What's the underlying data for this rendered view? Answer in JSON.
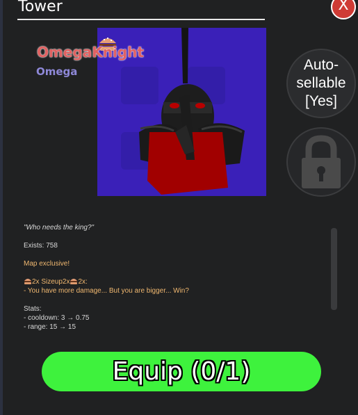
{
  "window": {
    "title": "Tower",
    "close_label": "X"
  },
  "tower": {
    "name": "OmegaKnight",
    "subtitle": "Omega",
    "icon": "burger-icon"
  },
  "autosell": {
    "line1": "Auto-",
    "line2": "sellable",
    "line3": "[Yes]"
  },
  "lock": {
    "icon": "padlock-icon",
    "locked": true
  },
  "description": {
    "quote": "\"Who needs the king?\"",
    "exists": "Exists: 758",
    "exclusive": "Map exclusive!",
    "ability_title": "2x Sizeup2x",
    "ability_suffix": "2x:",
    "ability_desc": "- You have more damage... But you are bigger... Win?",
    "stats_title": "Stats:",
    "stats": [
      "- cooldown: 3 → 0.75",
      "- range: 15 → 15"
    ]
  },
  "equip": {
    "label": "Equip (0/1)"
  },
  "colors": {
    "accent_green": "#3ef23d",
    "close_red": "#cf3b35",
    "preview_bg": "#3a20b8",
    "name_color": "#e06262"
  }
}
